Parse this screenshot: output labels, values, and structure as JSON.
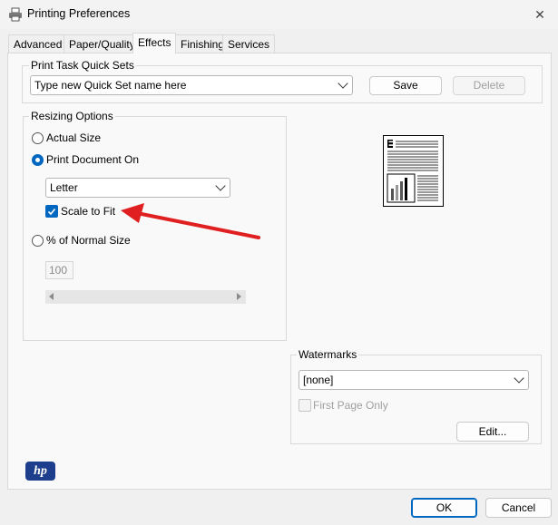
{
  "window": {
    "title": "Printing Preferences",
    "close_glyph": "✕"
  },
  "tabs": [
    {
      "label": "Advanced",
      "active": false
    },
    {
      "label": "Paper/Quality",
      "active": false
    },
    {
      "label": "Effects",
      "active": true
    },
    {
      "label": "Finishing",
      "active": false
    },
    {
      "label": "Services",
      "active": false
    }
  ],
  "quicksets": {
    "group_label": "Print Task Quick Sets",
    "value": "Type new Quick Set name here",
    "save_label": "Save",
    "delete_label": "Delete"
  },
  "resizing": {
    "group_label": "Resizing Options",
    "actual_size_label": "Actual Size",
    "print_on_label": "Print Document On",
    "paper_value": "Letter",
    "scale_to_fit_label": "Scale to Fit",
    "scale_to_fit_checked": true,
    "percent_label": "% of Normal Size",
    "percent_value": "100",
    "selected": "print_on"
  },
  "watermarks": {
    "group_label": "Watermarks",
    "value": "[none]",
    "first_page_label": "First Page Only",
    "first_page_checked": false,
    "edit_label": "Edit..."
  },
  "logo": {
    "text": "hp"
  },
  "footer": {
    "ok_label": "OK",
    "cancel_label": "Cancel"
  },
  "colors": {
    "accent": "#0067c0",
    "arrow": "#e02020",
    "hp_blue": "#1d3e8c"
  }
}
